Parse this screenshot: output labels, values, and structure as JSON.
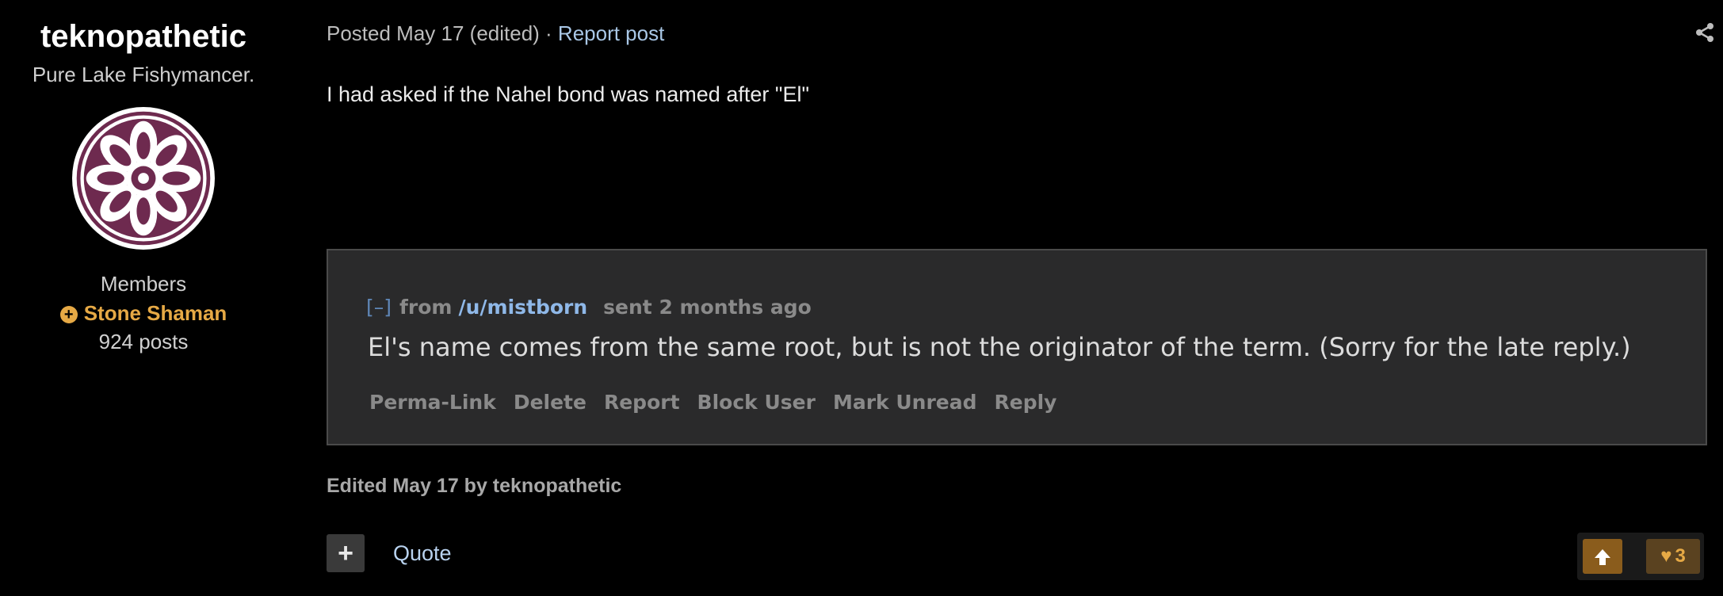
{
  "author": {
    "name": "teknopathetic",
    "title": "Pure Lake Fishymancer.",
    "group": "Members",
    "rank": "Stone Shaman",
    "posts": "924 posts",
    "avatar_color": "#6e2a4f"
  },
  "post": {
    "meta_text": "Posted May 17 (edited) · ",
    "report_link": "Report post",
    "body": "I had asked if the Nahel bond was named after \"El\"",
    "edited_note": "Edited May 17 by teknopathetic"
  },
  "embed": {
    "toggle": "[–]",
    "from_label": "from",
    "user": "/u/mistborn",
    "sent": "sent 2 months ago",
    "message": "El's name comes from the same root, but is not the originator of the term. (Sorry for the late reply.)",
    "actions": [
      "Perma-Link",
      "Delete",
      "Report",
      "Block User",
      "Mark Unread",
      "Reply"
    ]
  },
  "footer": {
    "plus": "+",
    "quote": "Quote",
    "like_count": "3"
  },
  "colors": {
    "accent_gold": "#e6a945",
    "link_blue": "#a9c7e6",
    "background": "#000000"
  },
  "icons": {
    "share": "share-icon",
    "upvote": "arrow-up-icon",
    "like": "heart-icon",
    "rank": "plus-circle-icon"
  }
}
